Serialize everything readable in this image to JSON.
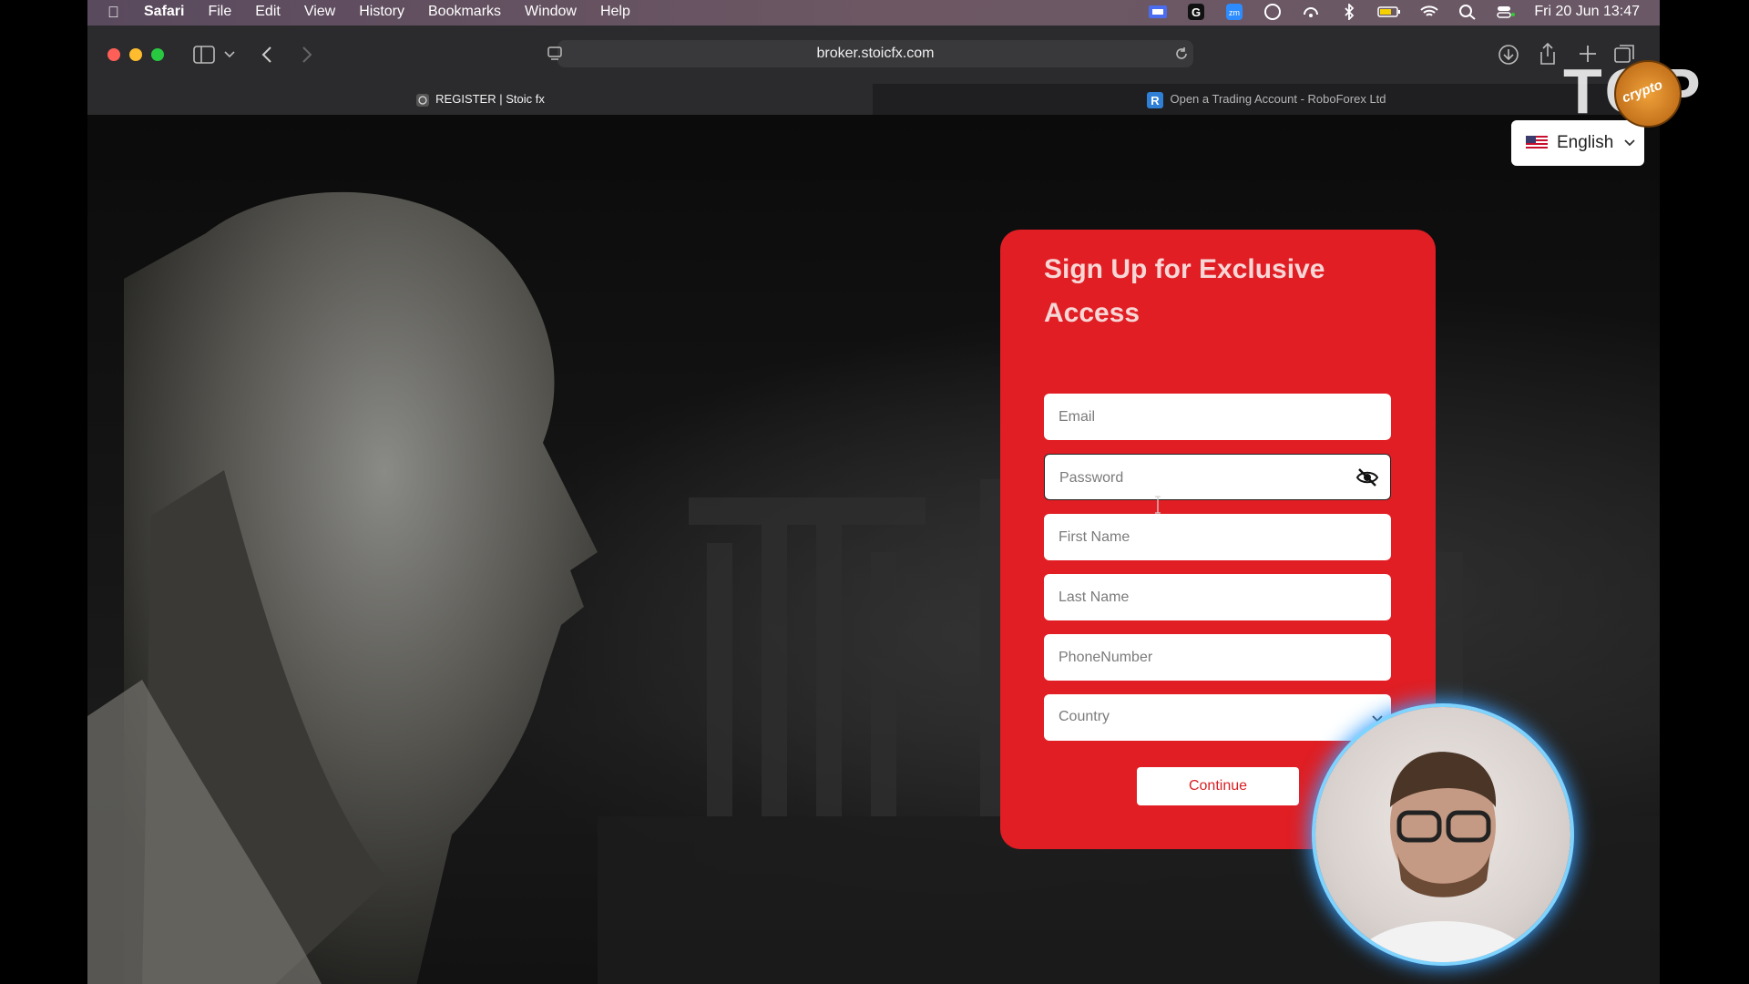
{
  "menubar": {
    "app": "Safari",
    "items": [
      "File",
      "Edit",
      "View",
      "History",
      "Bookmarks",
      "Window",
      "Help"
    ],
    "clock": "Fri 20 Jun  13:47"
  },
  "browser": {
    "url": "broker.stoicfx.com",
    "tabs": [
      {
        "title": "REGISTER | Stoic fx",
        "active": true
      },
      {
        "title": "Open a Trading Account - RoboForex Ltd",
        "active": false
      }
    ]
  },
  "page": {
    "language": "English",
    "form": {
      "title": "Sign Up for Exclusive Access",
      "email_placeholder": "Email",
      "password_placeholder": "Password",
      "first_name_placeholder": "First Name",
      "last_name_placeholder": "Last Name",
      "phone_placeholder": "PhoneNumber",
      "country_placeholder": "Country",
      "continue_label": "Continue"
    }
  },
  "overlay": {
    "logo_text": "TOP",
    "badge_text": "crypto"
  },
  "colors": {
    "form_bg": "#e01e24",
    "title_color": "#f7d6d6",
    "button_text": "#d82025"
  }
}
